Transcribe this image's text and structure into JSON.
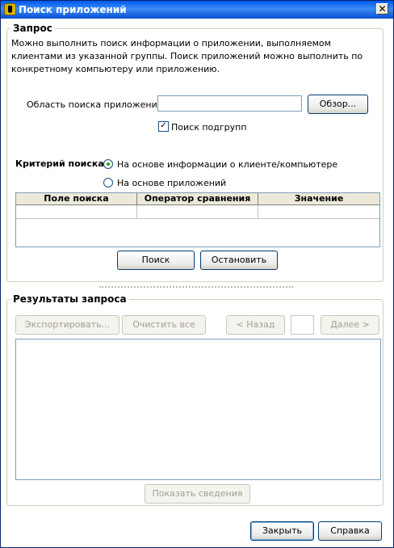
{
  "window": {
    "title": "Поиск приложений",
    "icon": "app-shield-icon",
    "close_symbol": "✕"
  },
  "query": {
    "title": "Запрос",
    "description": "Можно выполнить поиск информации о приложении, выполняемом клиентами из указанной группы.  Поиск приложений можно выполнить по конкретному компьютеру или приложению.",
    "search_area_label": "Область поиска приложений:",
    "search_area_value": "",
    "browse_label": "Обзор...",
    "subgroups_label": "Поиск подгрупп",
    "subgroups_checked": true,
    "criteria_label": "Критерий поиска:",
    "criteria_options": [
      {
        "label": "На основе информации о клиенте/компьютере",
        "checked": true
      },
      {
        "label": "На основе приложений",
        "checked": false
      }
    ],
    "table_columns": [
      "Поле поиска",
      "Оператор сравнения",
      "Значение"
    ],
    "search_button": "Поиск",
    "stop_button": "Остановить"
  },
  "results": {
    "title": "Результаты запроса",
    "export_button": "Экспортировать...",
    "clear_button": "Очистить все",
    "back_button": "< Назад",
    "page_value": "",
    "next_button": "Далее >",
    "details_button": "Показать сведения"
  },
  "footer": {
    "close_button": "Закрыть",
    "help_button": "Справка"
  },
  "colors": {
    "title_bar": "#0058ee",
    "window_bg": "#ece9d8",
    "button_border": "#003c74"
  }
}
